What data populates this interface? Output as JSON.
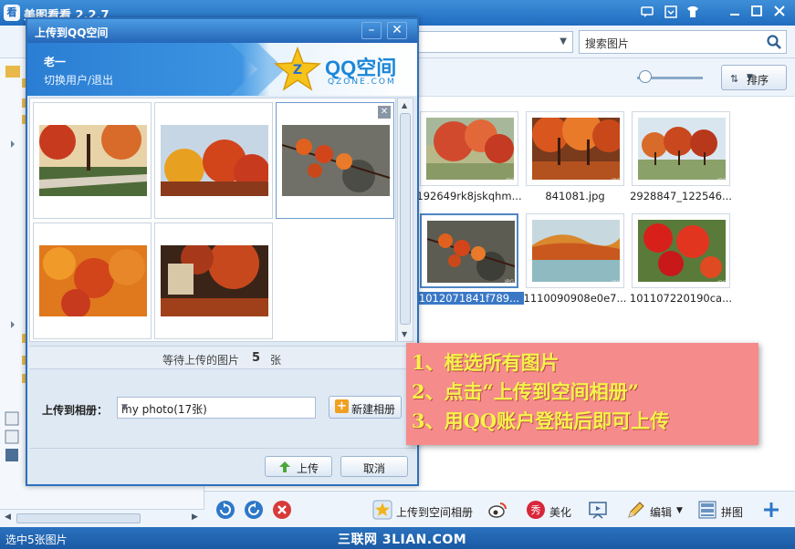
{
  "app": {
    "title": "美图看看 2.2.7",
    "icon_char": "看"
  },
  "toolbar": {
    "search_placeholder": "搜索图片"
  },
  "view": {
    "sort_label": "排序",
    "zoom_level": 0.15
  },
  "thumbnails": [
    {
      "name": "192649rk8jskqhm...",
      "tag": "JPG"
    },
    {
      "name": "841081.jpg",
      "tag": "JPG"
    },
    {
      "name": "2928847_122546...",
      "tag": "JPG"
    },
    {
      "name": "1012071841f789...",
      "tag": "JPG"
    },
    {
      "name": "1110090908e0e7...",
      "tag": "JPG"
    },
    {
      "name": "101107220190ca...",
      "tag": "JPG"
    }
  ],
  "bottom_toolbar": {
    "upload_qzone": "上传到空间相册",
    "beautify": "美化",
    "edit": "编辑",
    "stitch": "拼图"
  },
  "status": {
    "text": "选中5张图片",
    "watermark": "三联网 3LIAN.COM"
  },
  "dialog": {
    "title": "上传到QQ空间",
    "user": "老一",
    "switch_user": "切换用户/退出",
    "brand": "QQ空间",
    "brand_sub": "QZONE.COM",
    "waiting_text": "等待上传的图片",
    "waiting_count": "5",
    "waiting_unit": "张",
    "album_label": "上传到相册：",
    "album_value": "my photo(17张)",
    "new_album": "新建相册",
    "upload": "上传",
    "cancel": "取消"
  },
  "annotation": [
    "1、框选所有图片",
    "2、点击“上传到空间相册”",
    "3、用QQ账户登陆后即可上传"
  ],
  "colors": {
    "title_blue": "#1f6cc0",
    "accent": "#3a78c6",
    "note_bg": "#f58b8b",
    "note_text": "#f4f34a"
  }
}
